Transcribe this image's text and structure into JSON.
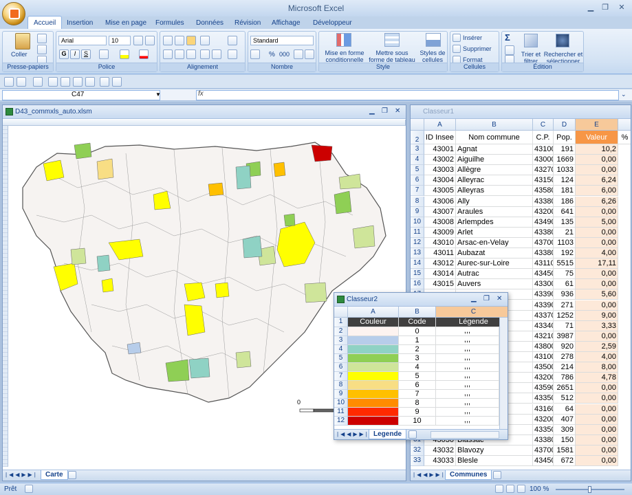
{
  "app": {
    "title": "Microsoft Excel"
  },
  "tabs": [
    "Accueil",
    "Insertion",
    "Mise en page",
    "Formules",
    "Données",
    "Révision",
    "Affichage",
    "Développeur"
  ],
  "ribbon": {
    "clipboard": {
      "label": "Presse-papiers",
      "paste": "Coller"
    },
    "police": {
      "label": "Police",
      "font": "Arial",
      "size": "10"
    },
    "alignement": {
      "label": "Alignement"
    },
    "nombre": {
      "label": "Nombre",
      "format": "Standard",
      "percent": "%",
      "thousands": "000"
    },
    "style": {
      "label": "Style",
      "cond": "Mise en forme conditionnelle",
      "table": "Mettre sous forme de tableau",
      "cells": "Styles de cellules"
    },
    "cellules": {
      "label": "Cellules",
      "insert": "Insérer",
      "delete": "Supprimer",
      "format": "Format"
    },
    "edition": {
      "label": "Édition",
      "sum": "Σ",
      "sort": "Trier et filtrer",
      "find": "Rechercher et sélectionner"
    }
  },
  "formula": {
    "namebox": "C47",
    "fx": "fx"
  },
  "win1": {
    "title": "D43_commxls_auto.xlsm",
    "sheet": "Carte",
    "scale_label": "0"
  },
  "win2": {
    "title": "Classeur1",
    "sheet": "Communes",
    "cols": [
      "A",
      "B",
      "C",
      "D",
      "E",
      ""
    ],
    "headers": [
      "ID Insee",
      "Nom commune",
      "C.P.",
      "Pop.",
      "Valeur",
      "%"
    ],
    "rows": [
      [
        "3",
        "43001",
        "Agnat",
        "43100",
        "191",
        "10,2"
      ],
      [
        "4",
        "43002",
        "Aiguilhe",
        "43000",
        "1669",
        "0,00"
      ],
      [
        "5",
        "43003",
        "Allègre",
        "43270",
        "1033",
        "0,00"
      ],
      [
        "6",
        "43004",
        "Alleyrac",
        "43150",
        "124",
        "6,24"
      ],
      [
        "7",
        "43005",
        "Alleyras",
        "43580",
        "181",
        "6,00"
      ],
      [
        "8",
        "43006",
        "Ally",
        "43380",
        "186",
        "6,26"
      ],
      [
        "9",
        "43007",
        "Araules",
        "43200",
        "641",
        "0,00"
      ],
      [
        "10",
        "43008",
        "Arlempdes",
        "43490",
        "135",
        "5,00"
      ],
      [
        "11",
        "43009",
        "Arlet",
        "43380",
        "21",
        "0,00"
      ],
      [
        "12",
        "43010",
        "Arsac-en-Velay",
        "43700",
        "1103",
        "0,00"
      ],
      [
        "13",
        "43011",
        "Aubazat",
        "43380",
        "192",
        "4,00"
      ],
      [
        "14",
        "43012",
        "Aurec-sur-Loire",
        "43110",
        "5515",
        "17,11"
      ],
      [
        "15",
        "43014",
        "Autrac",
        "43450",
        "75",
        "0,00"
      ],
      [
        "16",
        "43015",
        "Auvers",
        "43300",
        "61",
        "0,00"
      ],
      [
        "17",
        "",
        "",
        "43390",
        "936",
        "5,60"
      ],
      [
        "18",
        "",
        "",
        "43390",
        "271",
        "0,00"
      ],
      [
        "19",
        "",
        "",
        "43370",
        "1252",
        "9,00"
      ],
      [
        "20",
        "",
        "",
        "43340",
        "71",
        "3,33"
      ],
      [
        "21",
        "",
        "",
        "43210",
        "3987",
        "0,00"
      ],
      [
        "22",
        "",
        "",
        "43800",
        "920",
        "2,59"
      ],
      [
        "23",
        "",
        "",
        "43100",
        "278",
        "4,00"
      ],
      [
        "24",
        "",
        "on",
        "43500",
        "214",
        "8,00"
      ],
      [
        "25",
        "",
        "",
        "43200",
        "786",
        "4,78"
      ],
      [
        "26",
        "",
        "",
        "43590",
        "2651",
        "0,00"
      ],
      [
        "27",
        "",
        "ntagne",
        "43350",
        "512",
        "0,00"
      ],
      [
        "28",
        "",
        "",
        "43160",
        "64",
        "0,00"
      ],
      [
        "29",
        "",
        "",
        "43200",
        "407",
        "0,00"
      ],
      [
        "30",
        "",
        "",
        "43350",
        "309",
        "0,00"
      ],
      [
        "31",
        "43030",
        "Blassac",
        "43380",
        "150",
        "0,00"
      ],
      [
        "32",
        "43032",
        "Blavozy",
        "43700",
        "1581",
        "0,00"
      ],
      [
        "33",
        "43033",
        "Blesle",
        "43450",
        "672",
        "0,00"
      ]
    ]
  },
  "win3": {
    "title": "Classeur2",
    "sheet": "Legende",
    "cols": [
      "A",
      "B",
      "C"
    ],
    "headers": [
      "Couleur",
      "Code",
      "Légende"
    ],
    "rows": [
      {
        "n": "2",
        "code": "0",
        "leg": ",,,",
        "color": "#fdf3f0"
      },
      {
        "n": "3",
        "code": "1",
        "leg": ",,,",
        "color": "#b7cdea"
      },
      {
        "n": "4",
        "code": "2",
        "leg": ",,,",
        "color": "#8fd2c4"
      },
      {
        "n": "5",
        "code": "3",
        "leg": ",,,",
        "color": "#8fcf55"
      },
      {
        "n": "6",
        "code": "4",
        "leg": ",,,",
        "color": "#cfe59a"
      },
      {
        "n": "7",
        "code": "5",
        "leg": ",,,",
        "color": "#ffff00"
      },
      {
        "n": "8",
        "code": "6",
        "leg": ",,,",
        "color": "#f8de84"
      },
      {
        "n": "9",
        "code": "7",
        "leg": ",,,",
        "color": "#ffc000"
      },
      {
        "n": "10",
        "code": "8",
        "leg": ",,,",
        "color": "#ff8c00"
      },
      {
        "n": "11",
        "code": "9",
        "leg": ",,,",
        "color": "#ff2a00"
      },
      {
        "n": "12",
        "code": "10",
        "leg": ",,,",
        "color": "#cc0000"
      }
    ]
  },
  "status": {
    "ready": "Prêt",
    "zoom": "100 %"
  }
}
